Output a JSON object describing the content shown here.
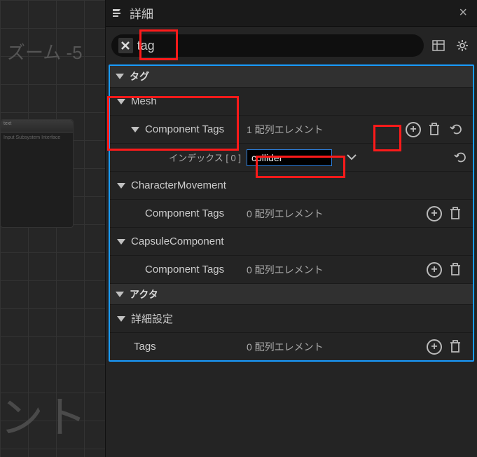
{
  "bg": {
    "zoom": "ズーム -5",
    "node_title": "text",
    "node_sub": "Input Subsystem Interface",
    "big_text": "ント"
  },
  "panel": {
    "title": "詳細",
    "search_value": "tag"
  },
  "categories": {
    "tag": "タグ",
    "actor": "アクタ"
  },
  "sections": {
    "mesh": "Mesh",
    "charMove": "CharacterMovement",
    "capsule": "CapsuleComponent",
    "advanced": "詳細設定"
  },
  "labels": {
    "componentTags": "Component Tags",
    "tags": "Tags",
    "index0": "インデックス [ 0 ]"
  },
  "values": {
    "oneElement": "1 配列エレメント",
    "zeroElement": "0 配列エレメント",
    "colliderInput": "collider"
  }
}
